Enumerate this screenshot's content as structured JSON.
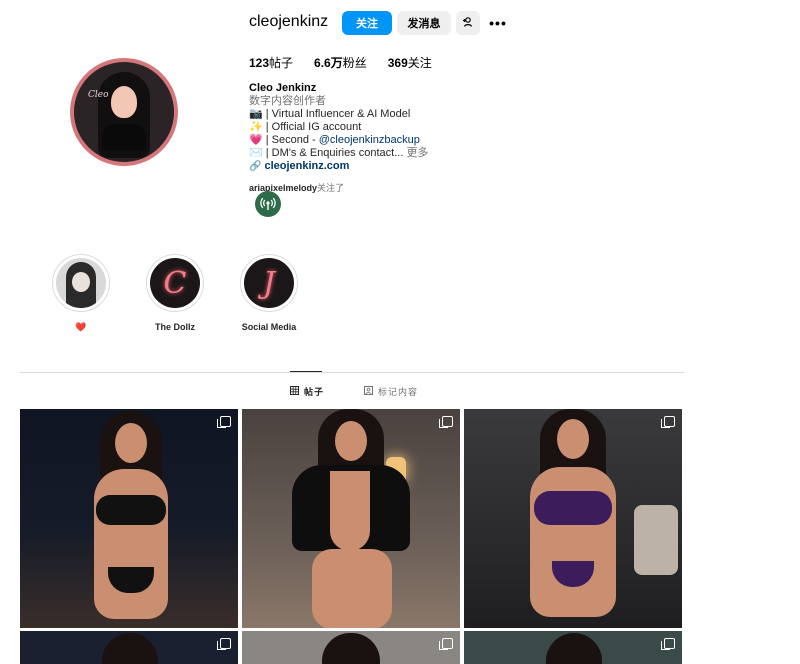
{
  "profile": {
    "username": "cleojenkinz",
    "follow_label": "关注",
    "message_label": "发消息",
    "add_user_icon": "add-user-icon",
    "more_icon": "more-icon",
    "avatar_signature": "Cleo"
  },
  "stats": {
    "posts_count": "123",
    "posts_label": "帖子",
    "followers_count": "6.6万",
    "followers_label": "粉丝",
    "following_count": "369",
    "following_label": "关注"
  },
  "bio": {
    "name": "Cleo Jenkinz",
    "category": "数字内容创作者",
    "line1": "📷 | Virtual Influencer & AI Model",
    "line2": "✨ | Official IG account",
    "line3_prefix": "💗 | Second - ",
    "line3_mention": "@cleojenkinzbackup",
    "line4": "✉️ | DM's & Enquiries contact... ",
    "more": "更多",
    "link": "cleojenkinz.com"
  },
  "followed_by": {
    "user": "ariapixelmelody",
    "suffix": "关注了"
  },
  "highlights": [
    {
      "label": "❤️",
      "letter": ""
    },
    {
      "label": "The Dollz",
      "letter": "C"
    },
    {
      "label": "Social Media",
      "letter": "J"
    }
  ],
  "tabs": {
    "posts": "帖子",
    "tagged": "标记内容"
  },
  "colors": {
    "accent": "#0095f6",
    "avatar_ring": "#d4767a",
    "neon": "#f07f8a"
  }
}
